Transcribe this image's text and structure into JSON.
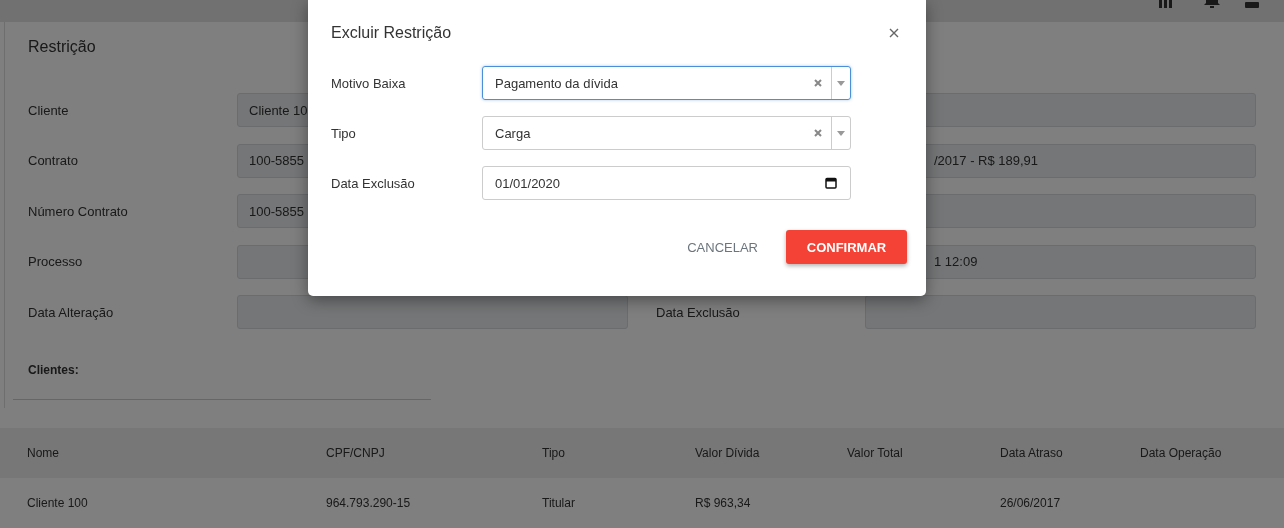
{
  "page": {
    "title": "Restrição",
    "rows": [
      {
        "label": "Cliente",
        "value": "Cliente 10"
      },
      {
        "label": "Contrato",
        "value": "100-5855",
        "right_value": "/2017 - R$ 189,91"
      },
      {
        "label": "Número Contrato",
        "value": "100-5855"
      },
      {
        "label": "Processo",
        "right_value": "1 12:09"
      },
      {
        "label": "Data Alteração",
        "right_label": "Data Exclusão"
      }
    ],
    "clients_heading": "Clientes:",
    "table": {
      "columns": [
        "Nome",
        "CPF/CNPJ",
        "Tipo",
        "Valor Dívida",
        "Valor Total",
        "Data Atraso",
        "Data Operação"
      ],
      "rows": [
        [
          "Cliente 100",
          "964.793.290-15",
          "Titular",
          "R$ 963,34",
          "",
          "26/06/2017",
          ""
        ]
      ]
    }
  },
  "modal": {
    "title": "Excluir Restrição",
    "fields": [
      {
        "kind": "select",
        "label": "Motivo Baixa",
        "value": "Pagamento da dívida",
        "focused": true
      },
      {
        "kind": "select",
        "label": "Tipo",
        "value": "Carga",
        "focused": false
      },
      {
        "kind": "date",
        "label": "Data Exclusão",
        "value": "01/01/2020",
        "focused": false
      }
    ],
    "cancel": "CANCELAR",
    "confirm": "CONFIRMAR"
  }
}
